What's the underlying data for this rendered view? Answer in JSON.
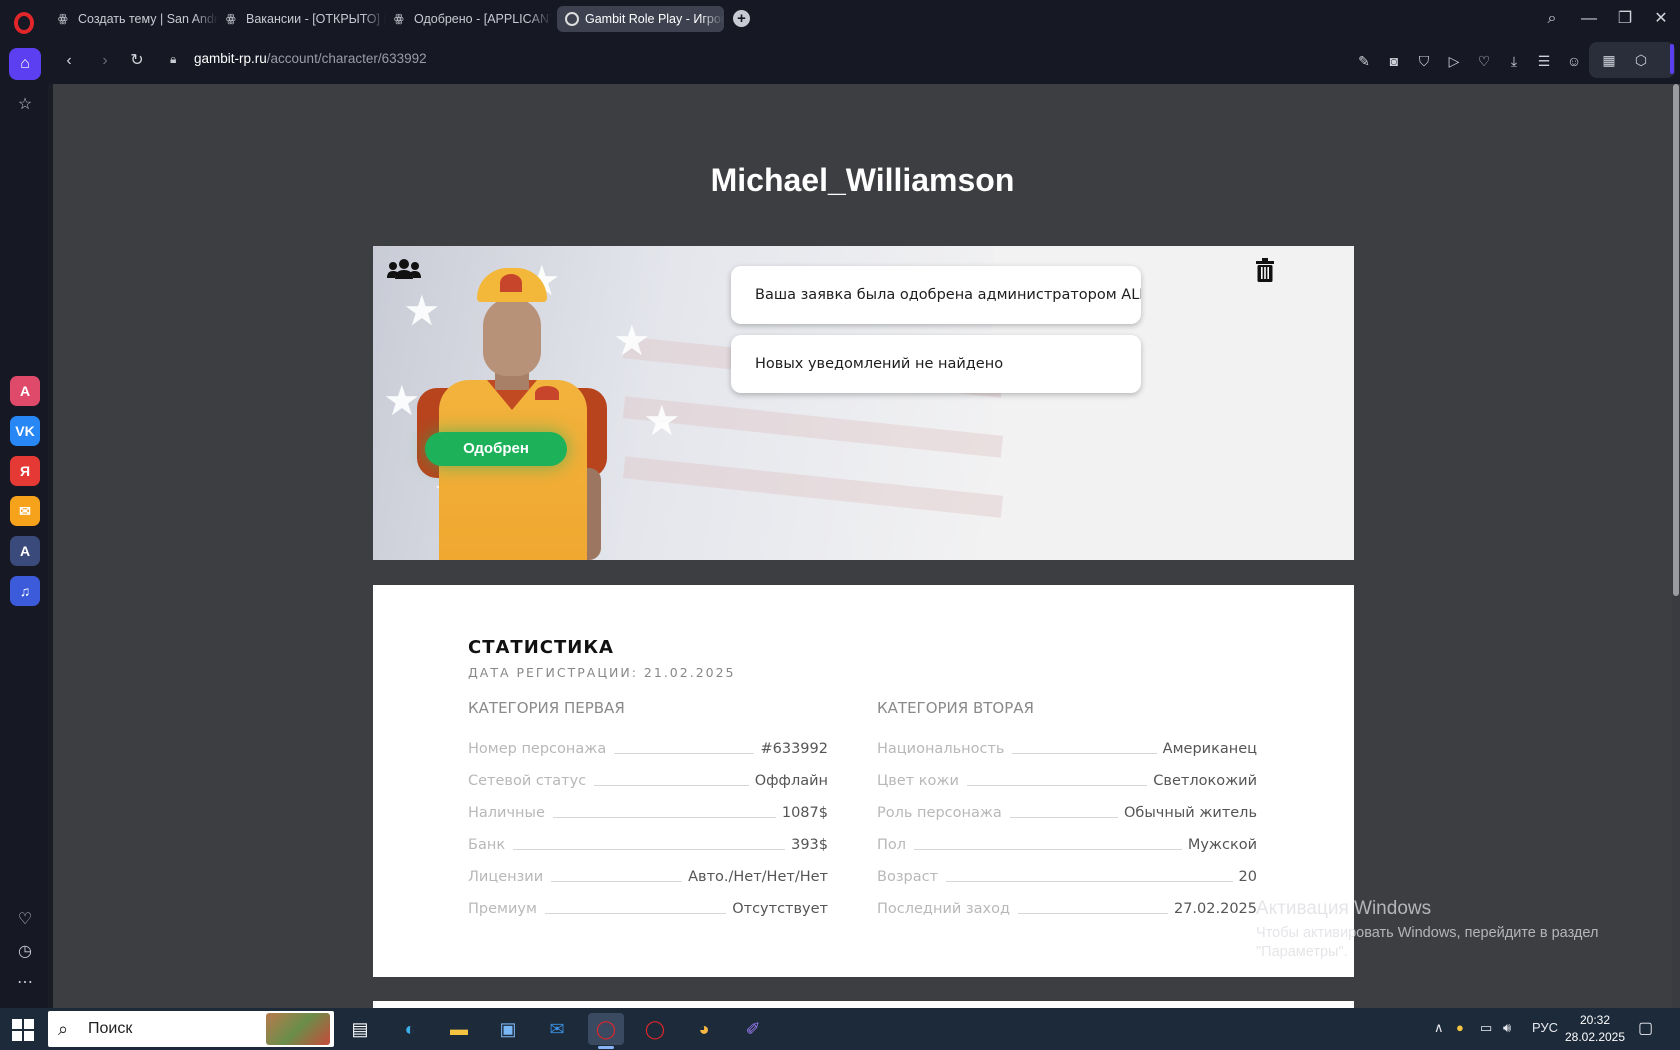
{
  "browser": {
    "tabs": [
      {
        "title": "Создать тему | San Andre",
        "active": false
      },
      {
        "title": "Вакансии - [ОТКРЫТО] П",
        "active": false
      },
      {
        "title": "Одобрено - [APPLICANT]",
        "active": false
      },
      {
        "title": "Gambit Role Play - Игров",
        "active": true
      }
    ],
    "url_host": "gambit-rp.ru",
    "url_path": "/account/character/633992"
  },
  "sidebar_apps": [
    {
      "name": "aria",
      "glyph": "A",
      "color": "#e04a6a"
    },
    {
      "name": "vk",
      "glyph": "VK",
      "color": "#2787f5"
    },
    {
      "name": "yandex",
      "glyph": "Я",
      "color": "#e53935"
    },
    {
      "name": "mail",
      "glyph": "✉",
      "color": "#f7a21b"
    },
    {
      "name": "translate",
      "glyph": "A",
      "color": "#3a4a7a"
    },
    {
      "name": "music",
      "glyph": "♫",
      "color": "#3b5bdb"
    }
  ],
  "page": {
    "title": "Michael_Williamson",
    "status_badge": "Одобрен",
    "notifications": [
      "Ваша заявка была одобрена администратором ALE...",
      "Новых уведомлений не найдено"
    ],
    "stats": {
      "title": "СТАТИСТИКА",
      "reg_date": "ДАТА РЕГИСТРАЦИИ: 21.02.2025",
      "category_one": {
        "heading": "КАТЕГОРИЯ ПЕРВАЯ",
        "rows": [
          {
            "label": "Номер персонажа",
            "value": "#633992"
          },
          {
            "label": "Сетевой статус",
            "value": "Оффлайн"
          },
          {
            "label": "Наличные",
            "value": "1087$"
          },
          {
            "label": "Банк",
            "value": "393$"
          },
          {
            "label": "Лицензии",
            "value": "Авто./Нет/Нет/Нет"
          },
          {
            "label": "Премиум",
            "value": "Отсутствует"
          }
        ]
      },
      "category_two": {
        "heading": "КАТЕГОРИЯ ВТОРАЯ",
        "rows": [
          {
            "label": "Национальность",
            "value": "Американец"
          },
          {
            "label": "Цвет кожи",
            "value": "Светлокожий"
          },
          {
            "label": "Роль персонажа",
            "value": "Обычный житель"
          },
          {
            "label": "Пол",
            "value": "Мужской"
          },
          {
            "label": "Возраст",
            "value": "20"
          },
          {
            "label": "Последний заход",
            "value": "27.02.2025"
          }
        ]
      }
    }
  },
  "watermark": {
    "line1": "Активация Windows",
    "line2": "Чтобы активировать Windows, перейдите в раздел",
    "line3": "\"Параметры\"."
  },
  "taskbar": {
    "search_placeholder": "Поиск",
    "language": "РУС",
    "time": "20:32",
    "date": "28.02.2025"
  }
}
